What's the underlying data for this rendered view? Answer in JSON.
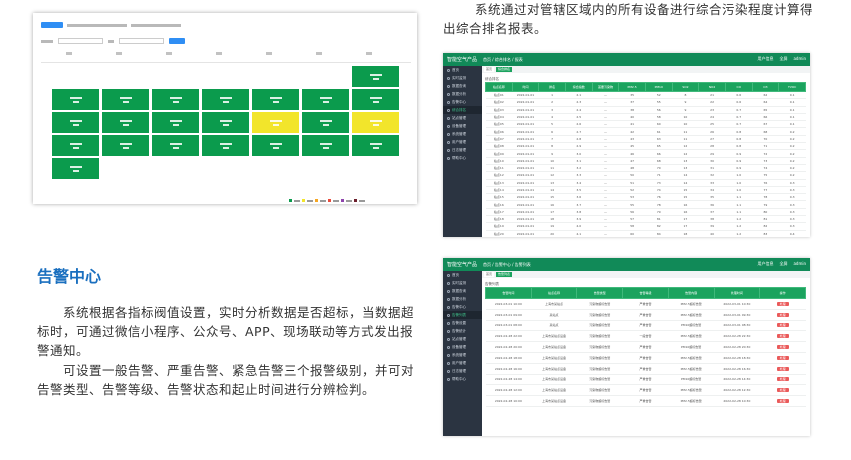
{
  "description_paragraph": "系统通过对管辖区域内的所有设备进行综合污染程度计算得出综合排名报表。",
  "alarm_section": {
    "heading": "告警中心",
    "paragraph_1": "系统根据各指标阀值设置，实时分析数据是否超标，当数据超标时，可通过微信小程序、公众号、APP、现场联动等方式发出报警通知。",
    "paragraph_2": "可设置一般告警、严重告警、紧急告警三个报警级别，并可对告警类型、告警等级、告警状态和起止时间进行分辨检判。"
  },
  "colors": {
    "header_green": "#118a58",
    "grid_green": "#0b9b4d",
    "grid_yellow": "#f2e52b",
    "heading_blue": "#1a6fbf",
    "sidebar_dark": "#2b3441",
    "alarm_red": "#ea5a5a"
  },
  "grid_map": {
    "rows": [
      [
        "",
        "",
        "",
        "",
        "",
        "",
        "green"
      ],
      [
        "green",
        "green",
        "green",
        "green",
        "green",
        "green",
        "green"
      ],
      [
        "green",
        "green",
        "green",
        "green",
        "yellow",
        "green",
        "yellow"
      ],
      [
        "green",
        "green",
        "green",
        "green",
        "green",
        "green",
        "green"
      ],
      [
        "green",
        "",
        "",
        "",
        "",
        "",
        ""
      ]
    ],
    "legend_colors": [
      "#0b9b4d",
      "#f2e52b",
      "#f5a623",
      "#e94b3c",
      "#8e44ad",
      "#6d1f2c"
    ]
  },
  "ranking_app": {
    "logo": "智能空气产品",
    "breadcrumb": "首页 / 综合排名 / 报表",
    "header_right": [
      "用户信息",
      "全屏",
      "admin"
    ],
    "sidebar_items": [
      "首页",
      "实时监测",
      "数据查询",
      "数据分析",
      "告警中心",
      "综合排名",
      "站点管理",
      "设备管理",
      "系统管理",
      "用户管理",
      "日志管理",
      "帮助中心"
    ],
    "active_sidebar_index": 5,
    "tabs": [
      "首页",
      "综合排名"
    ],
    "section_title": "综合排名",
    "columns": [
      "站点名称",
      "时间",
      "排名",
      "综合指数",
      "首要污染物",
      "PM2.5",
      "PM10",
      "SO2",
      "NO2",
      "CO",
      "O3",
      "TVOC"
    ],
    "rows": [
      [
        "站点01",
        "2022-01-01",
        "1",
        "2.1",
        "—",
        "35",
        "52",
        "8",
        "21",
        "0.6",
        "62",
        "0.1"
      ],
      [
        "站点02",
        "2022-01-01",
        "2",
        "2.3",
        "—",
        "37",
        "55",
        "9",
        "22",
        "0.6",
        "64",
        "0.1"
      ],
      [
        "站点03",
        "2022-01-01",
        "3",
        "2.4",
        "—",
        "38",
        "56",
        "9",
        "23",
        "0.7",
        "65",
        "0.1"
      ],
      [
        "站点04",
        "2022-01-01",
        "4",
        "2.5",
        "—",
        "40",
        "58",
        "10",
        "24",
        "0.7",
        "66",
        "0.1"
      ],
      [
        "站点05",
        "2022-01-01",
        "5",
        "2.6",
        "—",
        "41",
        "60",
        "10",
        "25",
        "0.7",
        "67",
        "0.1"
      ],
      [
        "站点06",
        "2022-01-01",
        "6",
        "2.7",
        "—",
        "42",
        "61",
        "11",
        "26",
        "0.8",
        "68",
        "0.2"
      ],
      [
        "站点07",
        "2022-01-01",
        "7",
        "2.8",
        "—",
        "43",
        "63",
        "11",
        "27",
        "0.8",
        "70",
        "0.2"
      ],
      [
        "站点08",
        "2022-01-01",
        "8",
        "2.9",
        "—",
        "45",
        "65",
        "12",
        "28",
        "0.8",
        "71",
        "0.2"
      ],
      [
        "站点09",
        "2022-01-01",
        "9",
        "3.0",
        "—",
        "46",
        "66",
        "12",
        "29",
        "0.9",
        "72",
        "0.2"
      ],
      [
        "站点10",
        "2022-01-01",
        "10",
        "3.1",
        "—",
        "47",
        "68",
        "13",
        "30",
        "0.9",
        "73",
        "0.2"
      ],
      [
        "站点11",
        "2022-01-01",
        "11",
        "3.2",
        "—",
        "48",
        "70",
        "13",
        "31",
        "0.9",
        "74",
        "0.2"
      ],
      [
        "站点12",
        "2022-01-01",
        "12",
        "3.3",
        "—",
        "50",
        "71",
        "14",
        "32",
        "1.0",
        "75",
        "0.2"
      ],
      [
        "站点13",
        "2022-01-01",
        "13",
        "3.4",
        "—",
        "51",
        "73",
        "14",
        "33",
        "1.0",
        "76",
        "0.3"
      ],
      [
        "站点14",
        "2022-01-01",
        "14",
        "3.5",
        "—",
        "52",
        "74",
        "15",
        "34",
        "1.0",
        "77",
        "0.3"
      ],
      [
        "站点15",
        "2022-01-01",
        "15",
        "3.6",
        "—",
        "53",
        "76",
        "15",
        "35",
        "1.1",
        "78",
        "0.3"
      ],
      [
        "站点16",
        "2022-01-01",
        "16",
        "3.7",
        "—",
        "55",
        "78",
        "16",
        "36",
        "1.1",
        "79",
        "0.3"
      ],
      [
        "站点17",
        "2022-01-01",
        "17",
        "3.8",
        "—",
        "56",
        "79",
        "16",
        "37",
        "1.1",
        "80",
        "0.3"
      ],
      [
        "站点18",
        "2022-01-01",
        "18",
        "3.9",
        "—",
        "57",
        "81",
        "17",
        "38",
        "1.2",
        "81",
        "0.3"
      ],
      [
        "站点19",
        "2022-01-01",
        "19",
        "4.0",
        "—",
        "58",
        "82",
        "17",
        "39",
        "1.2",
        "82",
        "0.3"
      ],
      [
        "站点20",
        "2022-01-01",
        "20",
        "4.1",
        "—",
        "60",
        "84",
        "18",
        "40",
        "1.2",
        "83",
        "0.4"
      ]
    ]
  },
  "alarm_app": {
    "logo": "智能空气产品",
    "breadcrumb": "首页 / 告警中心 / 告警列表",
    "header_right": [
      "用户信息",
      "全屏",
      "admin"
    ],
    "sidebar_items": [
      "首页",
      "实时监测",
      "数据查询",
      "数据分析",
      "告警中心",
      "告警列表",
      "告警设置",
      "告警统计",
      "站点管理",
      "设备管理",
      "系统管理",
      "用户管理",
      "日志管理",
      "帮助中心"
    ],
    "active_sidebar_index": 5,
    "tabs": [
      "首页",
      "告警列表"
    ],
    "section_title": "告警列表",
    "columns": [
      "告警时间",
      "站点名称",
      "告警类型",
      "告警等级",
      "告警内容",
      "处理时间",
      "操作"
    ],
    "rows": [
      [
        "2022-03-01 10:00",
        "上海市某站点",
        "污染物超标告警",
        "严重告警",
        "PM2.5超标告警",
        "2022-03-01 10:30",
        "处理"
      ],
      [
        "2022-03-01 09:00",
        "某站点",
        "污染物超标告警",
        "严重告警",
        "PM2.5超标告警",
        "2022-03-01 09:30",
        "处理"
      ],
      [
        "2022-03-01 08:00",
        "某站点",
        "污染物超标告警",
        "严重告警",
        "PM10超标告警",
        "2022-03-01 08:30",
        "处理"
      ],
      [
        "2022-02-28 22:00",
        "上海市某站点设备",
        "污染物超标告警",
        "一般告警",
        "PM2.5超标告警",
        "2022-02-28 22:30",
        "处理"
      ],
      [
        "2022-02-28 20:00",
        "上海市某站点设备",
        "污染物超标告警",
        "严重告警",
        "PM10超标告警",
        "2022-02-28 20:30",
        "处理"
      ],
      [
        "2022-02-28 18:00",
        "上海市某站点设备",
        "污染物超标告警",
        "严重告警",
        "PM2.5超标告警",
        "2022-02-28 18:30",
        "处理"
      ],
      [
        "2022-02-28 16:00",
        "上海市某站点设备",
        "污染物超标告警",
        "严重告警",
        "PM2.5超标告警",
        "2022-02-28 16:30",
        "处理"
      ],
      [
        "2022-02-28 14:00",
        "上海市某站点设备",
        "污染物超标告警",
        "严重告警",
        "PM10超标告警",
        "2022-02-28 14:30",
        "处理"
      ],
      [
        "2022-02-28 12:00",
        "上海市某站点设备",
        "污染物超标告警",
        "严重告警",
        "PM2.5超标告警",
        "2022-02-28 12:30",
        "处理"
      ],
      [
        "2022-02-28 10:00",
        "上海市某站点设备",
        "污染物超标告警",
        "严重告警",
        "PM2.5超标告警",
        "2022-02-28 10:30",
        "处理"
      ]
    ]
  }
}
